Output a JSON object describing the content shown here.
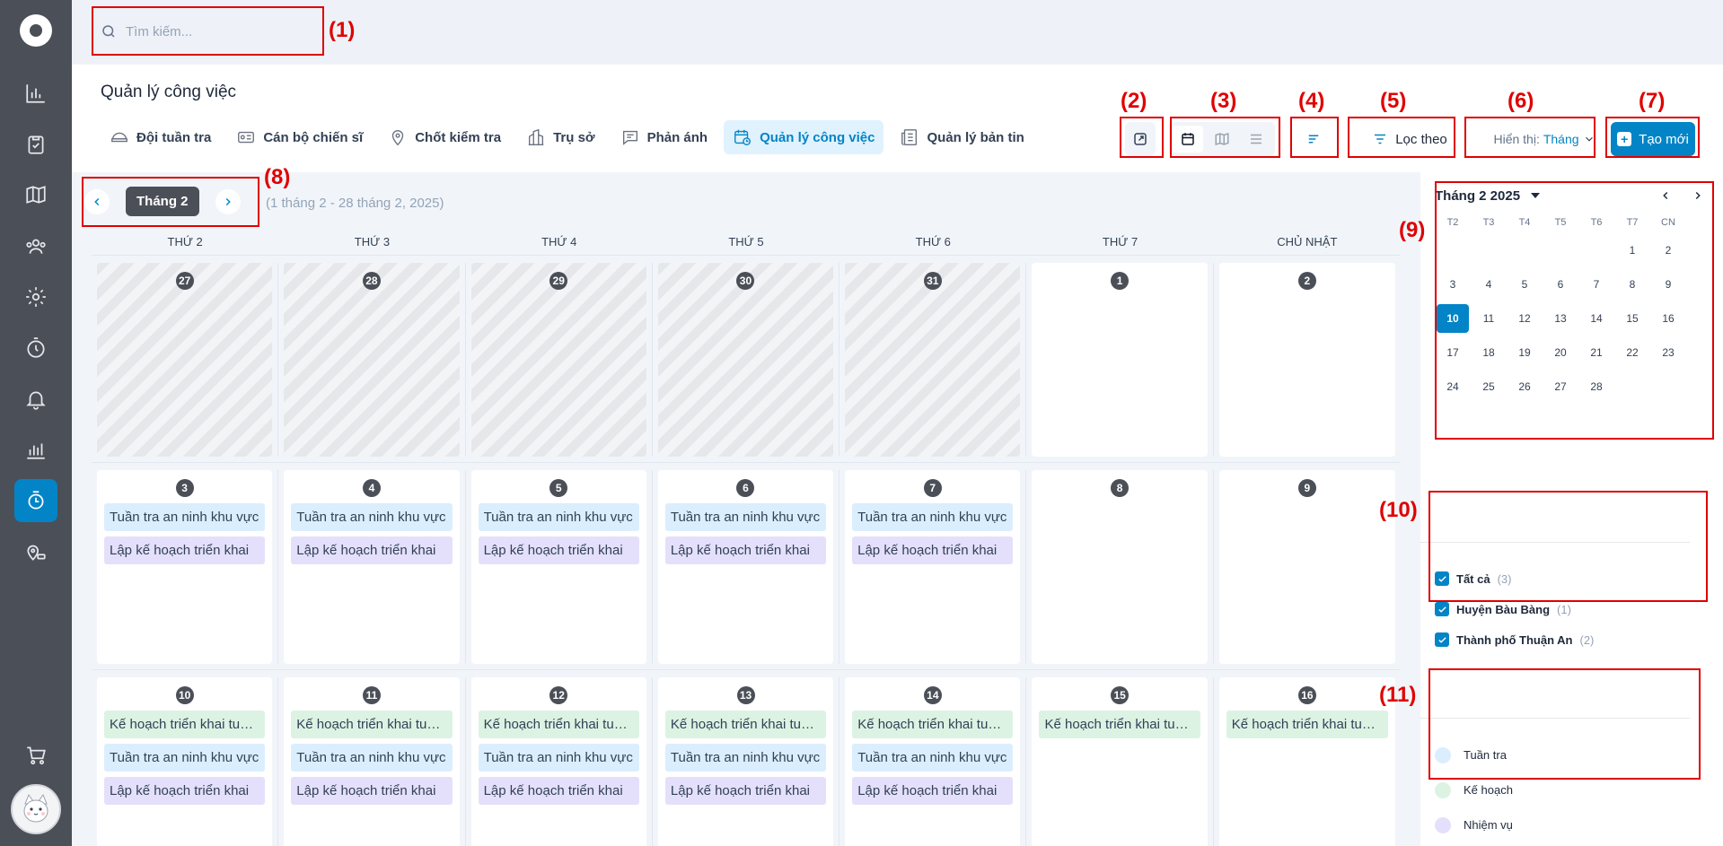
{
  "search": {
    "placeholder": "Tìm kiếm..."
  },
  "page": {
    "title": "Quản lý công việc"
  },
  "tabs": [
    {
      "label": "Đội tuần tra",
      "icon": "patrol-cap-icon"
    },
    {
      "label": "Cán bộ chiến sĩ",
      "icon": "id-card-icon"
    },
    {
      "label": "Chốt kiểm tra",
      "icon": "location-pin-icon"
    },
    {
      "label": "Trụ sở",
      "icon": "building-icon"
    },
    {
      "label": "Phản ánh",
      "icon": "chat-icon"
    },
    {
      "label": "Quản lý công việc",
      "icon": "calendar-clock-icon",
      "active": true
    },
    {
      "label": "Quản lý bản tin",
      "icon": "newspaper-icon"
    }
  ],
  "toolbar": {
    "filter_label": "Lọc theo",
    "display_prefix": "Hiển thị:",
    "display_value": "Tháng",
    "create_label": "Tạo mới"
  },
  "calendar": {
    "month_label": "Tháng 2",
    "range_text": "(1 tháng 2 - 28 tháng 2, 2025)",
    "weekdays": [
      "THỨ 2",
      "THỨ 3",
      "THỨ 4",
      "THỨ 5",
      "THỨ 6",
      "THỨ 7",
      "CHỦ NHẬT"
    ],
    "weeks": [
      [
        {
          "day": "27",
          "out": true,
          "events": []
        },
        {
          "day": "28",
          "out": true,
          "events": []
        },
        {
          "day": "29",
          "out": true,
          "events": []
        },
        {
          "day": "30",
          "out": true,
          "events": []
        },
        {
          "day": "31",
          "out": true,
          "events": []
        },
        {
          "day": "1",
          "out": false,
          "events": []
        },
        {
          "day": "2",
          "out": false,
          "events": []
        }
      ],
      [
        {
          "day": "3",
          "out": false,
          "events": [
            {
              "type": "patrol",
              "text": "Tuần tra an ninh khu vực"
            },
            {
              "type": "task",
              "text": "Lập kế hoạch triển khai"
            }
          ]
        },
        {
          "day": "4",
          "out": false,
          "events": [
            {
              "type": "patrol",
              "text": "Tuần tra an ninh khu vực"
            },
            {
              "type": "task",
              "text": "Lập kế hoạch triển khai"
            }
          ]
        },
        {
          "day": "5",
          "out": false,
          "events": [
            {
              "type": "patrol",
              "text": "Tuần tra an ninh khu vực"
            },
            {
              "type": "task",
              "text": "Lập kế hoạch triển khai"
            }
          ]
        },
        {
          "day": "6",
          "out": false,
          "events": [
            {
              "type": "patrol",
              "text": "Tuần tra an ninh khu vực"
            },
            {
              "type": "task",
              "text": "Lập kế hoạch triển khai"
            }
          ]
        },
        {
          "day": "7",
          "out": false,
          "events": [
            {
              "type": "patrol",
              "text": "Tuần tra an ninh khu vực"
            },
            {
              "type": "task",
              "text": "Lập kế hoạch triển khai"
            }
          ]
        },
        {
          "day": "8",
          "out": false,
          "events": []
        },
        {
          "day": "9",
          "out": false,
          "events": []
        }
      ],
      [
        {
          "day": "10",
          "out": false,
          "events": [
            {
              "type": "plan",
              "text": "Kế hoạch triển khai tuần tra"
            },
            {
              "type": "patrol",
              "text": "Tuần tra an ninh khu vực"
            },
            {
              "type": "task",
              "text": "Lập kế hoạch triển khai"
            }
          ]
        },
        {
          "day": "11",
          "out": false,
          "events": [
            {
              "type": "plan",
              "text": "Kế hoạch triển khai tuần tra"
            },
            {
              "type": "patrol",
              "text": "Tuần tra an ninh khu vực"
            },
            {
              "type": "task",
              "text": "Lập kế hoạch triển khai"
            }
          ]
        },
        {
          "day": "12",
          "out": false,
          "events": [
            {
              "type": "plan",
              "text": "Kế hoạch triển khai tuần tra"
            },
            {
              "type": "patrol",
              "text": "Tuần tra an ninh khu vực"
            },
            {
              "type": "task",
              "text": "Lập kế hoạch triển khai"
            }
          ]
        },
        {
          "day": "13",
          "out": false,
          "events": [
            {
              "type": "plan",
              "text": "Kế hoạch triển khai tuần tra"
            },
            {
              "type": "patrol",
              "text": "Tuần tra an ninh khu vực"
            },
            {
              "type": "task",
              "text": "Lập kế hoạch triển khai"
            }
          ]
        },
        {
          "day": "14",
          "out": false,
          "events": [
            {
              "type": "plan",
              "text": "Kế hoạch triển khai tuần tra"
            },
            {
              "type": "patrol",
              "text": "Tuần tra an ninh khu vực"
            },
            {
              "type": "task",
              "text": "Lập kế hoạch triển khai"
            }
          ]
        },
        {
          "day": "15",
          "out": false,
          "events": [
            {
              "type": "plan",
              "text": "Kế hoạch triển khai tuần tra"
            }
          ]
        },
        {
          "day": "16",
          "out": false,
          "events": [
            {
              "type": "plan",
              "text": "Kế hoạch triển khai tuần tra"
            }
          ]
        }
      ]
    ]
  },
  "mini_calendar": {
    "title": "Tháng 2 2025",
    "weekdays": [
      "T2",
      "T3",
      "T4",
      "T5",
      "T6",
      "T7",
      "CN"
    ],
    "weeks": [
      [
        "",
        "",
        "",
        "",
        "",
        "1",
        "2"
      ],
      [
        "3",
        "4",
        "5",
        "6",
        "7",
        "8",
        "9"
      ],
      [
        "10",
        "11",
        "12",
        "13",
        "14",
        "15",
        "16"
      ],
      [
        "17",
        "18",
        "19",
        "20",
        "21",
        "22",
        "23"
      ],
      [
        "24",
        "25",
        "26",
        "27",
        "28",
        "",
        ""
      ]
    ],
    "selected": "10"
  },
  "filters": [
    {
      "label": "Tất cả",
      "count": "(3)",
      "checked": true
    },
    {
      "label": "Huyện Bàu Bàng",
      "count": "(1)",
      "checked": true
    },
    {
      "label": "Thành phố Thuận An",
      "count": "(2)",
      "checked": true
    }
  ],
  "legend": [
    {
      "label": "Tuần tra",
      "color": "#dbeefe"
    },
    {
      "label": "Kế hoạch",
      "color": "#dcf3e4"
    },
    {
      "label": "Nhiệm vụ",
      "color": "#e4e0fb"
    }
  ],
  "annotations": [
    "(1)",
    "(2)",
    "(3)",
    "(4)",
    "(5)",
    "(6)",
    "(7)",
    "(8)",
    "(9)",
    "(10)",
    "(11)"
  ],
  "colors": {
    "accent": "#0284c7",
    "sidebar": "#4b4f57",
    "annotation": "#e00000"
  }
}
